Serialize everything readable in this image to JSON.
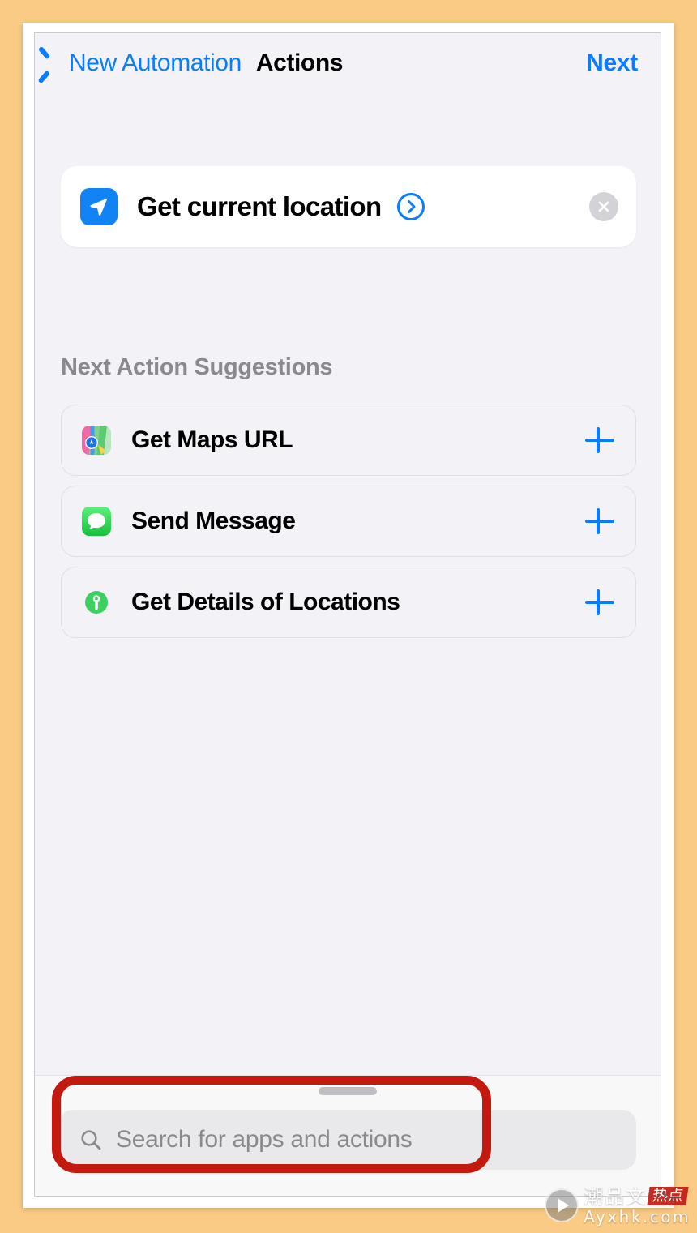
{
  "theme": {
    "page_background": "#F9CB85",
    "screen_background": "#F2F2F7",
    "accent_blue": "#0A7CFF",
    "annotation_red": "#C4190E",
    "messages_green": "#4CD964",
    "location_blue": "#1283F5"
  },
  "navbar": {
    "back_label": "New Automation",
    "title": "Actions",
    "next_label": "Next",
    "back_icon": "chevron-left-icon"
  },
  "action_card": {
    "icon": "location-arrow-icon",
    "label": "Get current location",
    "disclosure_icon": "chevron-right-circle-icon",
    "remove_icon": "close-circle-icon"
  },
  "suggestions_section": {
    "header": "Next Action Suggestions",
    "items": [
      {
        "icon": "maps-app-icon",
        "label": "Get Maps URL",
        "add_icon": "plus-icon"
      },
      {
        "icon": "messages-app-icon",
        "label": "Send Message",
        "add_icon": "plus-icon"
      },
      {
        "icon": "location-pin-icon",
        "label": "Get Details of Locations",
        "add_icon": "plus-icon"
      }
    ]
  },
  "bottom_sheet": {
    "grabber": "drag-handle",
    "search": {
      "icon": "search-icon",
      "value": "",
      "placeholder": "Search for apps and actions"
    }
  },
  "annotation": {
    "shape": "rounded-rectangle-highlight",
    "target": "search-field"
  },
  "watermark": {
    "play_icon": "play-circle-icon",
    "brand_cn": "潮品文",
    "badge_cn": "热点",
    "url": "Ayxhk.com"
  }
}
